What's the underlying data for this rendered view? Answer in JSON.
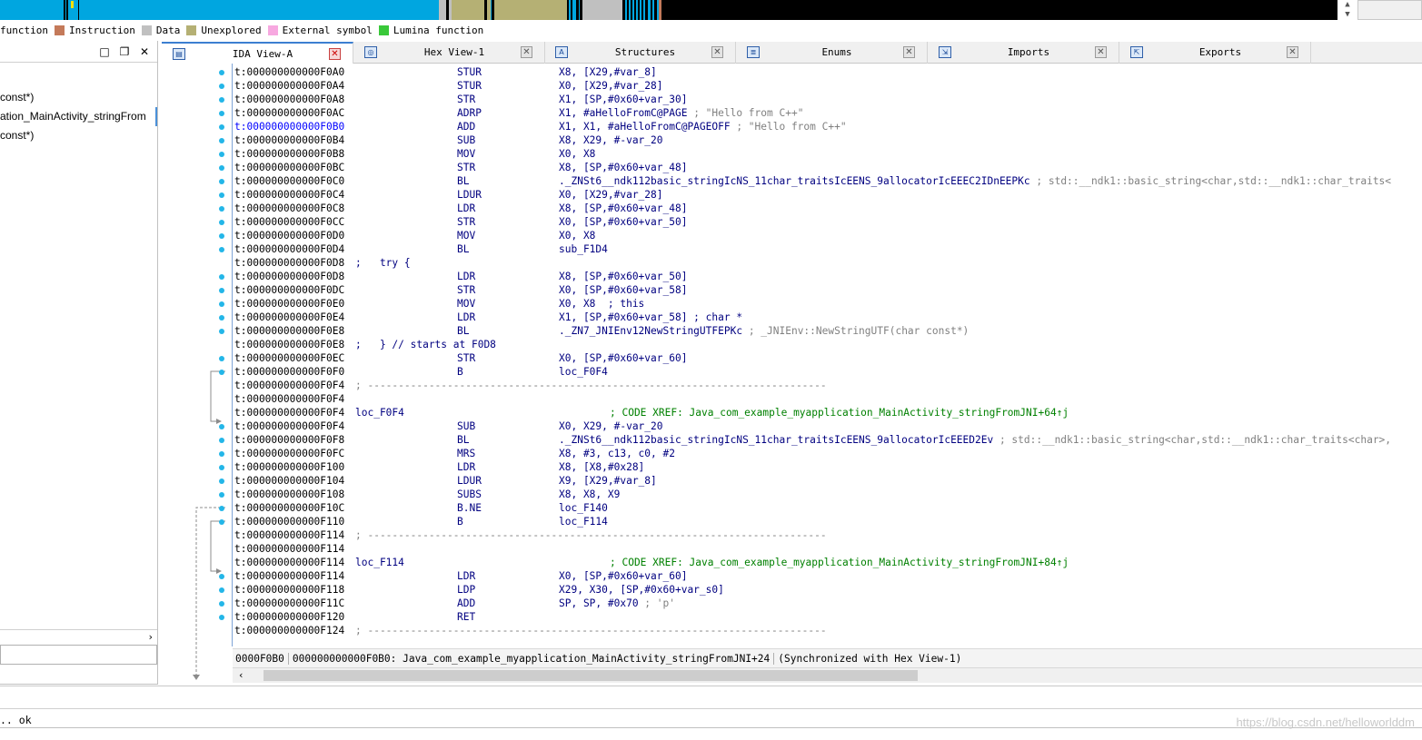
{
  "nav_band": {
    "colors": {
      "regular_function": "#00a6e0",
      "instruction": "#c47a5a",
      "data": "#c0c0c0",
      "unexplored": "#b5b074",
      "external_symbol": "#f7a8e0",
      "lumina_function": "#39c839",
      "end": "#000000"
    }
  },
  "legend": [
    {
      "label": "function",
      "color": "#00a6e0"
    },
    {
      "label": "Instruction",
      "color": "#c47a5a"
    },
    {
      "label": "Data",
      "color": "#c0c0c0"
    },
    {
      "label": "Unexplored",
      "color": "#b5b074"
    },
    {
      "label": "External symbol",
      "color": "#f7a8e0"
    },
    {
      "label": "Lumina function",
      "color": "#39c839"
    }
  ],
  "left_panel": {
    "buttons": {
      "restore": "□",
      "float": "❐",
      "close": "✕"
    },
    "items": [
      "const*)",
      "ation_MainActivity_stringFrom",
      "const*)"
    ],
    "scroll_right": "›"
  },
  "tabs": [
    {
      "label": "IDA View-A",
      "icon": "ida-view-icon",
      "active": true
    },
    {
      "label": "Hex View-1",
      "icon": "hex-view-icon",
      "active": false
    },
    {
      "label": "Structures",
      "icon": "structures-icon",
      "active": false
    },
    {
      "label": "Enums",
      "icon": "enums-icon",
      "active": false
    },
    {
      "label": "Imports",
      "icon": "imports-icon",
      "active": false
    },
    {
      "label": "Exports",
      "icon": "exports-icon",
      "active": false
    }
  ],
  "disasm": [
    {
      "addr": "t:000000000000F0A0",
      "mn": "STUR",
      "op": "X8, [X29,#var_8]",
      "cmt": ""
    },
    {
      "addr": "t:000000000000F0A4",
      "mn": "STUR",
      "op": "X0, [X29,#var_28]",
      "cmt": ""
    },
    {
      "addr": "t:000000000000F0A8",
      "mn": "STR",
      "op": "X1, [SP,#0x60+var_30]",
      "cmt": ""
    },
    {
      "addr": "t:000000000000F0AC",
      "mn": "ADRP",
      "op": "X1, #aHelloFromC@PAGE",
      "cmt": " ; \"Hello from C++\""
    },
    {
      "addr": "t:000000000000F0B0",
      "mn": "ADD",
      "op": "X1, X1, #aHelloFromC@PAGEOFF",
      "cmt": " ; \"Hello from C++\"",
      "hl": true
    },
    {
      "addr": "t:000000000000F0B4",
      "mn": "SUB",
      "op": "X8, X29, #-var_20",
      "cmt": ""
    },
    {
      "addr": "t:000000000000F0B8",
      "mn": "MOV",
      "op": "X0, X8",
      "cmt": ""
    },
    {
      "addr": "t:000000000000F0BC",
      "mn": "STR",
      "op": "X8, [SP,#0x60+var_48]",
      "cmt": ""
    },
    {
      "addr": "t:000000000000F0C0",
      "mn": "BL",
      "op": "._ZNSt6__ndk112basic_stringIcNS_11char_traitsIcEENS_9allocatorIcEEEC2IDnEEPKc",
      "cmt": " ; std::__ndk1::basic_string<char,std::__ndk1::char_traits<"
    },
    {
      "addr": "t:000000000000F0C4",
      "mn": "LDUR",
      "op": "X0, [X29,#var_28]",
      "cmt": ""
    },
    {
      "addr": "t:000000000000F0C8",
      "mn": "LDR",
      "op": "X8, [SP,#0x60+var_48]",
      "cmt": ""
    },
    {
      "addr": "t:000000000000F0CC",
      "mn": "STR",
      "op": "X0, [SP,#0x60+var_50]",
      "cmt": ""
    },
    {
      "addr": "t:000000000000F0D0",
      "mn": "MOV",
      "op": "X0, X8",
      "cmt": ""
    },
    {
      "addr": "t:000000000000F0D4",
      "mn": "BL",
      "op": "sub_F1D4",
      "cmt": ""
    },
    {
      "addr": "t:000000000000F0D8",
      "try": ";   try {"
    },
    {
      "addr": "t:000000000000F0D8",
      "mn": "LDR",
      "op": "X8, [SP,#0x60+var_50]",
      "cmt": ""
    },
    {
      "addr": "t:000000000000F0DC",
      "mn": "STR",
      "op": "X0, [SP,#0x60+var_58]",
      "cmt": ""
    },
    {
      "addr": "t:000000000000F0E0",
      "mn": "MOV",
      "op": "X0, X8  ; this",
      "cmt": ""
    },
    {
      "addr": "t:000000000000F0E4",
      "mn": "LDR",
      "op": "X1, [SP,#0x60+var_58] ; char *",
      "cmt": ""
    },
    {
      "addr": "t:000000000000F0E8",
      "mn": "BL",
      "op": "._ZN7_JNIEnv12NewStringUTFEPKc",
      "cmt": " ; _JNIEnv::NewStringUTF(char const*)"
    },
    {
      "addr": "t:000000000000F0E8",
      "try": ";   } // starts at F0D8"
    },
    {
      "addr": "t:000000000000F0EC",
      "mn": "STR",
      "op": "X0, [SP,#0x60+var_60]",
      "cmt": ""
    },
    {
      "addr": "t:000000000000F0F0",
      "mn": "B",
      "op": "loc_F0F4",
      "cmt": ""
    },
    {
      "addr": "t:000000000000F0F4",
      "sep": "; ---------------------------------------------------------------------------"
    },
    {
      "addr": "t:000000000000F0F4"
    },
    {
      "addr": "t:000000000000F0F4",
      "label": "loc_F0F4",
      "xref": "; CODE XREF: Java_com_example_myapplication_MainActivity_stringFromJNI+64↑j"
    },
    {
      "addr": "t:000000000000F0F4",
      "mn": "SUB",
      "op": "X0, X29, #-var_20",
      "cmt": ""
    },
    {
      "addr": "t:000000000000F0F8",
      "mn": "BL",
      "op": "._ZNSt6__ndk112basic_stringIcNS_11char_traitsIcEENS_9allocatorIcEEED2Ev",
      "cmt": " ; std::__ndk1::basic_string<char,std::__ndk1::char_traits<char>,"
    },
    {
      "addr": "t:000000000000F0FC",
      "mn": "MRS",
      "op": "X8, #3, c13, c0, #2",
      "cmt": ""
    },
    {
      "addr": "t:000000000000F100",
      "mn": "LDR",
      "op": "X8, [X8,#0x28]",
      "cmt": ""
    },
    {
      "addr": "t:000000000000F104",
      "mn": "LDUR",
      "op": "X9, [X29,#var_8]",
      "cmt": ""
    },
    {
      "addr": "t:000000000000F108",
      "mn": "SUBS",
      "op": "X8, X8, X9",
      "cmt": ""
    },
    {
      "addr": "t:000000000000F10C",
      "mn": "B.NE",
      "op": "loc_F140",
      "cmt": ""
    },
    {
      "addr": "t:000000000000F110",
      "mn": "B",
      "op": "loc_F114",
      "cmt": ""
    },
    {
      "addr": "t:000000000000F114",
      "sep": "; ---------------------------------------------------------------------------"
    },
    {
      "addr": "t:000000000000F114"
    },
    {
      "addr": "t:000000000000F114",
      "label": "loc_F114",
      "xref": "; CODE XREF: Java_com_example_myapplication_MainActivity_stringFromJNI+84↑j"
    },
    {
      "addr": "t:000000000000F114",
      "mn": "LDR",
      "op": "X0, [SP,#0x60+var_60]",
      "cmt": ""
    },
    {
      "addr": "t:000000000000F118",
      "mn": "LDP",
      "op": "X29, X30, [SP,#0x60+var_s0]",
      "cmt": ""
    },
    {
      "addr": "t:000000000000F11C",
      "mn": "ADD",
      "op": "SP, SP, #0x70",
      "cmt": " ; 'p'"
    },
    {
      "addr": "t:000000000000F120",
      "mn": "RET",
      "op": "",
      "cmt": ""
    },
    {
      "addr": "t:000000000000F124",
      "sep": "; ---------------------------------------------------------------------------"
    }
  ],
  "status": {
    "offset": "0000F0B0",
    "location": "000000000000F0B0: Java_com_example_myapplication_MainActivity_stringFromJNI+24",
    "sync": "(Synchronized with Hex View-1)"
  },
  "output": {
    "text": ".. ok"
  },
  "watermark": "https://blog.csdn.net/helloworlddm"
}
